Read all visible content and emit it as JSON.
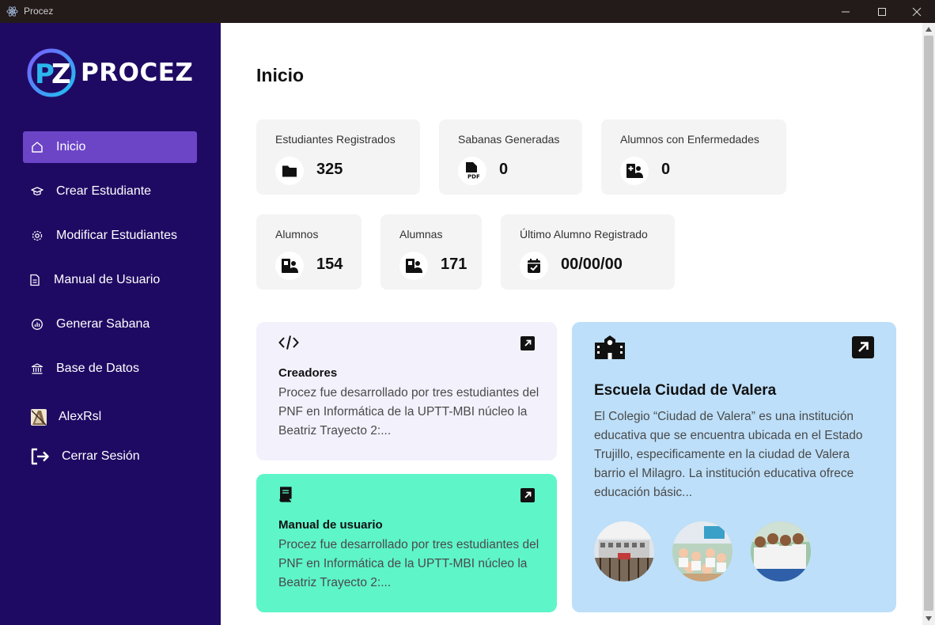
{
  "window": {
    "title": "Procez"
  },
  "sidebar": {
    "brand": "PROCEZ",
    "items": [
      {
        "label": "Inicio",
        "icon": "home-icon",
        "active": true
      },
      {
        "label": "Crear Estudiante",
        "icon": "graduation-cap-icon"
      },
      {
        "label": "Modificar Estudiantes",
        "icon": "gear-icon"
      },
      {
        "label": "Manual de Usuario",
        "icon": "document-icon"
      },
      {
        "label": "Generar Sabana",
        "icon": "report-chart-icon"
      },
      {
        "label": "Base de Datos",
        "icon": "database-bank-icon"
      }
    ],
    "user": {
      "name": "AlexRsl"
    },
    "logout": {
      "label": "Cerrar Sesión",
      "icon": "logout-icon"
    }
  },
  "main": {
    "title": "Inicio",
    "stats": [
      {
        "label": "Estudiantes Registrados",
        "value": "325",
        "icon": "folder-icon"
      },
      {
        "label": "Sabanas Generadas",
        "value": "0",
        "icon": "pdf-file-icon"
      },
      {
        "label": "Alumnos con Enfermedades",
        "value": "0",
        "icon": "medical-person-icon"
      },
      {
        "label": "Alumnos",
        "value": "154",
        "icon": "male-student-icon"
      },
      {
        "label": "Alumnas",
        "value": "171",
        "icon": "female-student-icon"
      },
      {
        "label": "Último Alumno Registrado",
        "value": "00/00/00",
        "icon": "calendar-check-icon"
      }
    ],
    "cards": {
      "creadores": {
        "title": "Creadores",
        "text": "Procez fue desarrollado por tres estudiantes del PNF en Informática de la UPTT-MBI núcleo la Beatriz Trayecto 2:...",
        "icon": "code-icon",
        "color": "#f3f1fc"
      },
      "manual": {
        "title": "Manual de usuario",
        "text": "Procez fue desarrollado por tres estudiantes del PNF en Informática de la UPTT-MBI núcleo la Beatriz Trayecto 2:...",
        "icon": "book-icon",
        "color": "#5ef5c9"
      },
      "escuela": {
        "title": "Escuela Ciudad de Valera",
        "text": "El Colegio “Ciudad de Valera” es una institución educativa que se encuentra ubicada en el Estado Trujillo, especificamente en la ciudad de Valera barrio el Milagro. La institución educativa ofrece educación básic...",
        "icon": "school-building-icon",
        "color": "#bddff9"
      }
    }
  },
  "colors": {
    "sidebar": "#1f0a63",
    "active_item": "#6c45c7",
    "titlebar": "#231a1a"
  }
}
